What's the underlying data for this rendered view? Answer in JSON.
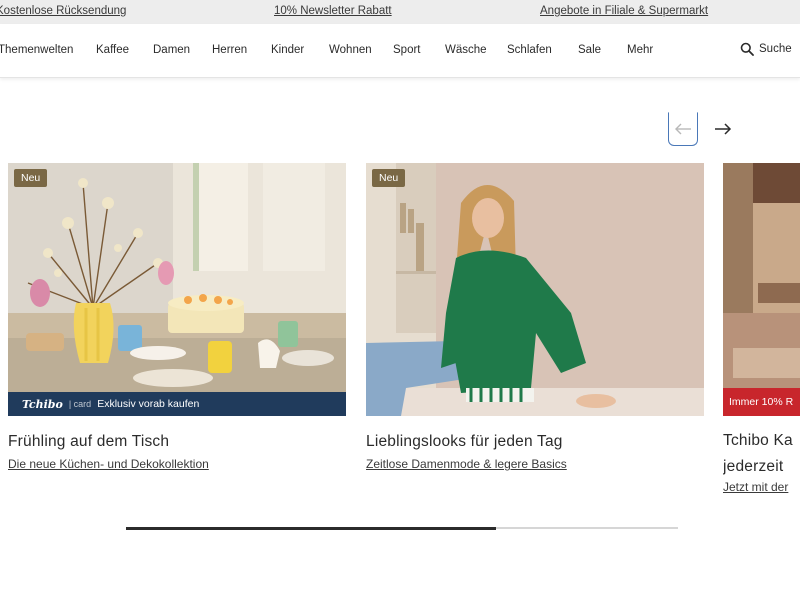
{
  "promo_bar": {
    "items": [
      "Kostenlose Rücksendung",
      "10% Newsletter Rabatt",
      "Angebote in Filiale & Supermarkt"
    ]
  },
  "nav": {
    "items": [
      "Themenwelten",
      "Kaffee",
      "Damen",
      "Herren",
      "Kinder",
      "Wohnen",
      "Sport",
      "Wäsche",
      "Schlafen",
      "Sale",
      "Mehr"
    ],
    "search_label": "Suche"
  },
  "carousel": {
    "progress_fraction": 0.67,
    "cards": [
      {
        "badge": "Neu",
        "title": "Frühling auf dem Tisch",
        "subtitle": "Die neue Küchen- und Dekokollektion",
        "banner_brand": "Tchibo",
        "banner_card": "card",
        "banner_text": "Exklusiv vorab kaufen"
      },
      {
        "badge": "Neu",
        "title": "Lieblingslooks für jeden Tag",
        "subtitle": "Zeitlose Damenmode & legere Basics"
      },
      {
        "title": "Tchibo Ka",
        "title_line2": "jederzeit",
        "subtitle": "Jetzt mit der",
        "promo_text": "Immer 10% R"
      }
    ]
  },
  "colors": {
    "badge": "#7a6845",
    "exclusive_bar": "#203b5c",
    "promo_red": "#c8262c",
    "arrow_focus": "#4a78b8"
  }
}
